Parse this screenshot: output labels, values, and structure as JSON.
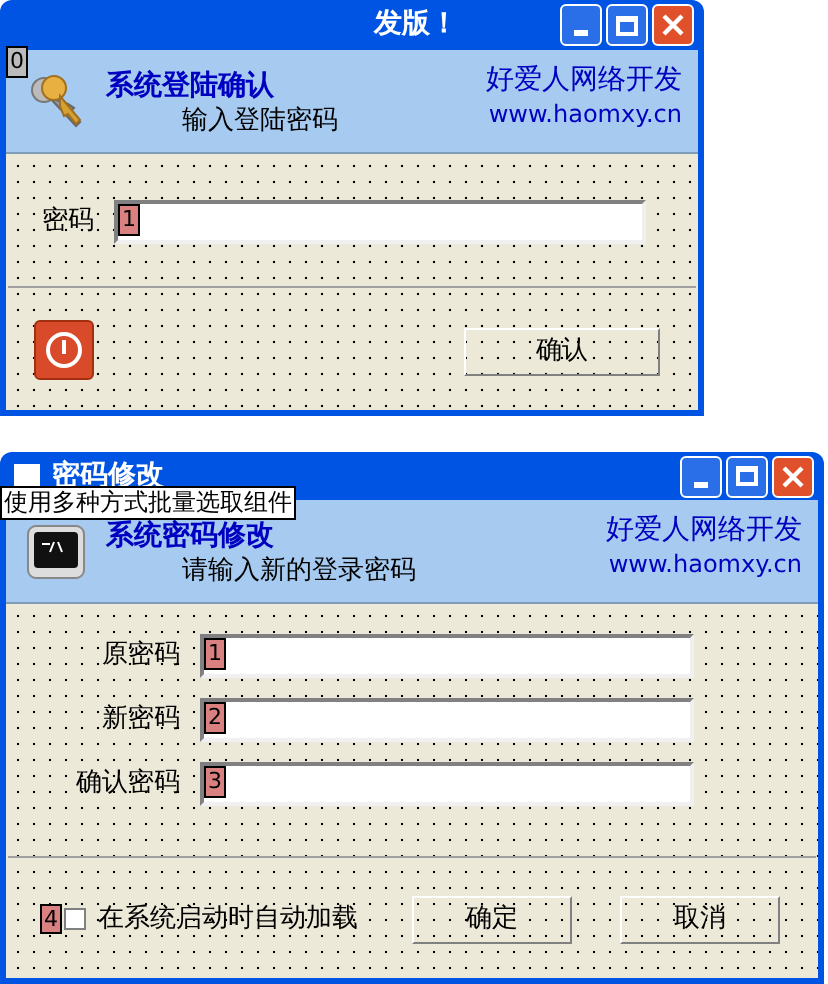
{
  "login_window": {
    "title": "发版！",
    "header": {
      "icon_tab_order": "0",
      "title": "系统登陆确认",
      "subtitle": "输入登陆密码",
      "brand": "好爱人网络开发",
      "url": "www.haomxy.cn"
    },
    "fields": [
      {
        "label": "密码",
        "tab_order": "1"
      }
    ],
    "confirm_button": "确认"
  },
  "password_window": {
    "title": "密码修改",
    "tooltip": "使用多种方式批量选取组件",
    "header": {
      "title": "系统密码修改",
      "subtitle": "请输入新的登录密码",
      "brand": "好爱人网络开发",
      "url": "www.haomxy.cn"
    },
    "fields": [
      {
        "label": "原密码",
        "tab_order": "1"
      },
      {
        "label": "新密码",
        "tab_order": "2"
      },
      {
        "label": "确认密码",
        "tab_order": "3"
      }
    ],
    "autoload": {
      "label": "在系统启动时自动加载",
      "tab_order": "4",
      "checked": false
    },
    "buttons": [
      "确定",
      "取消"
    ]
  }
}
